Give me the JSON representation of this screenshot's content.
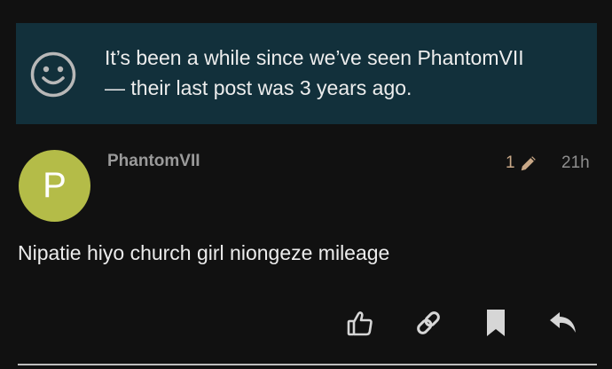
{
  "notice": {
    "icon": "smile-icon",
    "text_line1": "It’s been a while since we’ve seen PhantomVII",
    "text_line2": "— their last post was 3 years ago."
  },
  "post": {
    "avatar_letter": "P",
    "avatar_color": "#b4bc48",
    "username": "PhantomVII",
    "edit_count": "1",
    "edit_icon": "pencil-icon",
    "time_ago": "21h",
    "body": "Nipatie hiyo church girl niongeze mileage"
  },
  "actions": {
    "like_icon": "thumbs-up-icon",
    "share_icon": "link-icon",
    "bookmark_icon": "bookmark-icon",
    "reply_icon": "reply-icon"
  },
  "colors": {
    "background": "#111111",
    "notice_background": "#12303b",
    "edit_accent": "#c9a887"
  }
}
